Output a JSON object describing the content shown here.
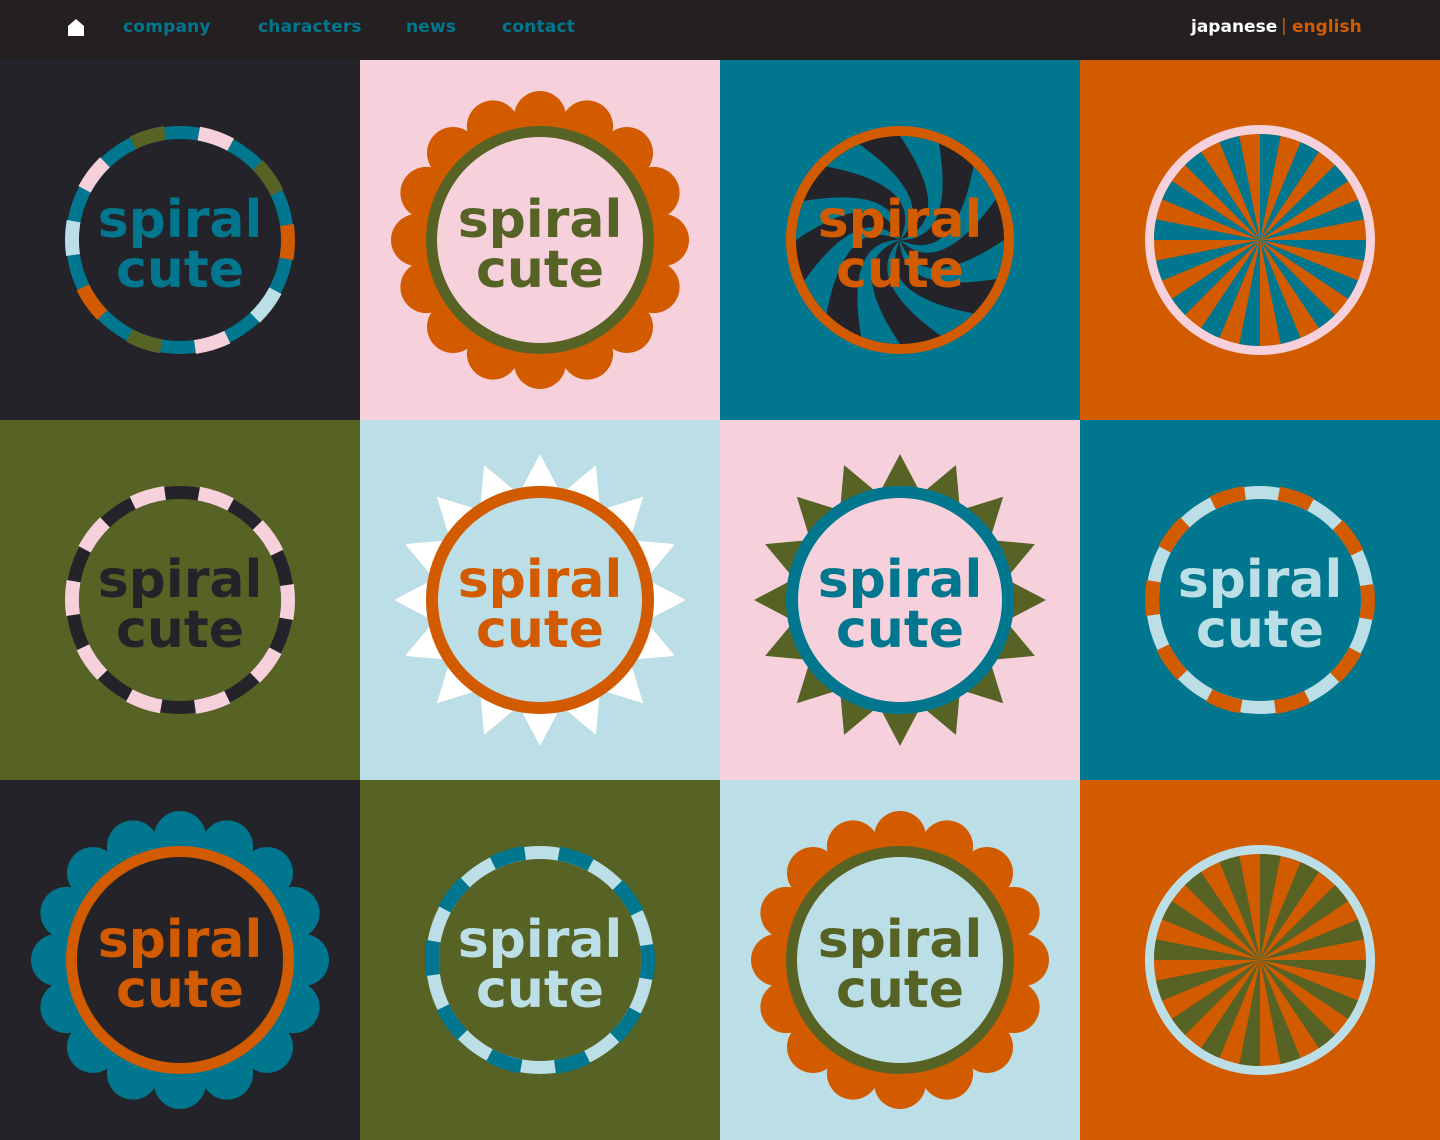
{
  "nav": {
    "items": [
      {
        "label": "company"
      },
      {
        "label": "characters"
      },
      {
        "label": "news"
      },
      {
        "label": "contact"
      }
    ],
    "lang_japanese": "japanese",
    "lang_separator": "|",
    "lang_english": "english"
  },
  "colors": {
    "navy": "#242329",
    "pink": "#f6d0db",
    "teal": "#00778e",
    "orange": "#d25b00",
    "olive": "#566325",
    "lightblue": "#bcdee6",
    "white": "#ffffff"
  },
  "tiles": [
    {
      "bg": "navy",
      "style": "striped-ring",
      "ring": [
        "teal",
        "pink",
        "olive",
        "orange",
        "lightblue"
      ],
      "text_color": "teal",
      "line1": "spiral",
      "line2": "cute"
    },
    {
      "bg": "pink",
      "style": "scallop",
      "deco": "orange",
      "ring": [
        "olive"
      ],
      "text_color": "olive",
      "line1": "spiral",
      "line2": "cute"
    },
    {
      "bg": "teal",
      "style": "swirl",
      "deco": "navy",
      "ring": [
        "orange"
      ],
      "text_color": "orange",
      "line1": "spiral",
      "line2": "cute"
    },
    {
      "bg": "orange",
      "style": "pinwheel",
      "deco": "teal",
      "ring": [
        "pink"
      ],
      "text_color": "",
      "line1": "",
      "line2": ""
    },
    {
      "bg": "olive",
      "style": "striped-ring",
      "ring": [
        "navy",
        "pink"
      ],
      "text_color": "navy",
      "line1": "spiral",
      "line2": "cute"
    },
    {
      "bg": "lightblue",
      "style": "starburst",
      "deco": "white",
      "ring": [
        "orange"
      ],
      "text_color": "orange",
      "line1": "spiral",
      "line2": "cute"
    },
    {
      "bg": "pink",
      "style": "starburst",
      "deco": "olive",
      "ring": [
        "teal"
      ],
      "text_color": "teal",
      "line1": "spiral",
      "line2": "cute"
    },
    {
      "bg": "teal",
      "style": "striped-ring",
      "ring": [
        "lightblue",
        "orange"
      ],
      "text_color": "lightblue",
      "line1": "spiral",
      "line2": "cute"
    },
    {
      "bg": "navy",
      "style": "scallop",
      "deco": "teal",
      "ring": [
        "orange"
      ],
      "text_color": "orange",
      "line1": "spiral",
      "line2": "cute"
    },
    {
      "bg": "olive",
      "style": "striped-ring",
      "ring": [
        "lightblue",
        "teal"
      ],
      "text_color": "lightblue",
      "line1": "spiral",
      "line2": "cute"
    },
    {
      "bg": "lightblue",
      "style": "scallop",
      "deco": "orange",
      "ring": [
        "olive"
      ],
      "text_color": "olive",
      "line1": "spiral",
      "line2": "cute"
    },
    {
      "bg": "orange",
      "style": "pinwheel",
      "deco": "olive",
      "ring": [
        "lightblue"
      ],
      "text_color": "",
      "line1": "",
      "line2": ""
    }
  ]
}
